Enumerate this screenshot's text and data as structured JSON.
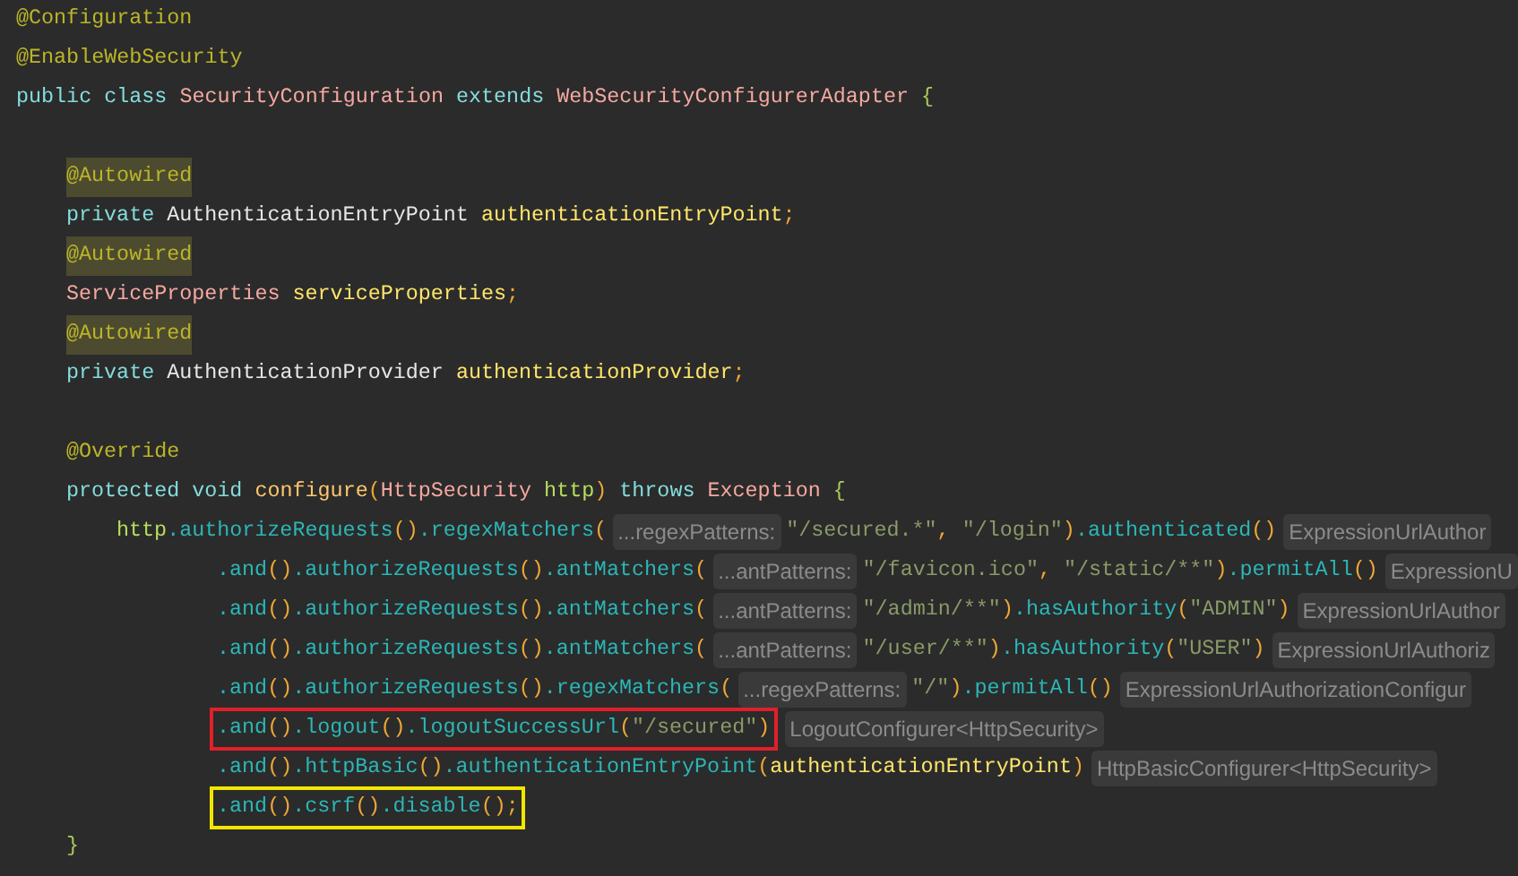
{
  "lines": [
    {
      "kind": "code",
      "tokens": [
        {
          "kind": "annotation",
          "text": "@Configuration",
          "highlighted": false
        }
      ]
    },
    {
      "kind": "code",
      "tokens": [
        {
          "kind": "annotation",
          "text": "@EnableWebSecurity",
          "highlighted": false
        }
      ]
    },
    {
      "kind": "code",
      "tokens": [
        {
          "kind": "keyword",
          "text": "public class "
        },
        {
          "kind": "type",
          "text": "SecurityConfiguration "
        },
        {
          "kind": "keyword",
          "text": "extends "
        },
        {
          "kind": "type",
          "text": "WebSecurityConfigurerAdapter "
        },
        {
          "kind": "brace",
          "text": "{"
        }
      ],
      "children": [
        {
          "kind": "blank"
        },
        {
          "kind": "code",
          "tokens": [
            {
              "kind": "annotation",
              "text": "@Autowired",
              "highlighted": true
            }
          ]
        },
        {
          "kind": "code",
          "tokens": [
            {
              "kind": "keyword",
              "text": "private "
            },
            {
              "kind": "plain",
              "text": "AuthenticationEntryPoint "
            },
            {
              "kind": "field",
              "text": "authenticationEntryPoint"
            },
            {
              "kind": "paren",
              "text": ";"
            }
          ]
        },
        {
          "kind": "code",
          "tokens": [
            {
              "kind": "annotation",
              "text": "@Autowired",
              "highlighted": true
            }
          ]
        },
        {
          "kind": "code",
          "tokens": [
            {
              "kind": "type",
              "text": "ServiceProperties "
            },
            {
              "kind": "field",
              "text": "serviceProperties"
            },
            {
              "kind": "paren",
              "text": ";"
            }
          ]
        },
        {
          "kind": "code",
          "tokens": [
            {
              "kind": "annotation",
              "text": "@Autowired",
              "highlighted": true
            }
          ]
        },
        {
          "kind": "code",
          "tokens": [
            {
              "kind": "keyword",
              "text": "private "
            },
            {
              "kind": "plain",
              "text": "AuthenticationProvider "
            },
            {
              "kind": "field",
              "text": "authenticationProvider"
            },
            {
              "kind": "paren",
              "text": ";"
            }
          ]
        },
        {
          "kind": "blank"
        },
        {
          "kind": "code",
          "tokens": [
            {
              "kind": "annotation",
              "text": "@Override",
              "highlighted": false
            }
          ]
        },
        {
          "kind": "code",
          "tokens": [
            {
              "kind": "keyword",
              "text": "protected void "
            },
            {
              "kind": "method-decl",
              "text": "configure"
            },
            {
              "kind": "paren",
              "text": "("
            },
            {
              "kind": "type",
              "text": "HttpSecurity "
            },
            {
              "kind": "variable",
              "text": "http"
            },
            {
              "kind": "paren",
              "text": ") "
            },
            {
              "kind": "keyword",
              "text": "throws "
            },
            {
              "kind": "type",
              "text": "Exception "
            },
            {
              "kind": "brace",
              "text": "{"
            }
          ],
          "children": [
            {
              "kind": "code",
              "tokens": [
                {
                  "kind": "variable",
                  "text": "http"
                },
                {
                  "kind": "method",
                  "text": ".authorizeRequests"
                },
                {
                  "kind": "paren",
                  "text": "()"
                },
                {
                  "kind": "method",
                  "text": ".regexMatchers"
                },
                {
                  "kind": "paren",
                  "text": "("
                },
                {
                  "kind": "param-hint",
                  "text": "...regexPatterns:"
                },
                {
                  "kind": "string",
                  "text": "\"/secured.*\""
                },
                {
                  "kind": "paren",
                  "text": ", "
                },
                {
                  "kind": "string",
                  "text": "\"/login\""
                },
                {
                  "kind": "paren",
                  "text": ")"
                },
                {
                  "kind": "method",
                  "text": ".authenticated"
                },
                {
                  "kind": "paren",
                  "text": "()"
                }
              ],
              "inlay": "ExpressionUrlAuthor",
              "children": [
                {
                  "kind": "code",
                  "tokens": [
                    {
                      "kind": "method",
                      "text": ".and"
                    },
                    {
                      "kind": "paren",
                      "text": "()"
                    },
                    {
                      "kind": "method",
                      "text": ".authorizeRequests"
                    },
                    {
                      "kind": "paren",
                      "text": "()"
                    },
                    {
                      "kind": "method",
                      "text": ".antMatchers"
                    },
                    {
                      "kind": "paren",
                      "text": "("
                    },
                    {
                      "kind": "param-hint",
                      "text": "...antPatterns:"
                    },
                    {
                      "kind": "string",
                      "text": "\"/favicon.ico\""
                    },
                    {
                      "kind": "paren",
                      "text": ", "
                    },
                    {
                      "kind": "string",
                      "text": "\"/static/**\""
                    },
                    {
                      "kind": "paren",
                      "text": ")"
                    },
                    {
                      "kind": "method",
                      "text": ".permitAll"
                    },
                    {
                      "kind": "paren",
                      "text": "()"
                    }
                  ],
                  "inlay": "ExpressionU"
                },
                {
                  "kind": "code",
                  "tokens": [
                    {
                      "kind": "method",
                      "text": ".and"
                    },
                    {
                      "kind": "paren",
                      "text": "()"
                    },
                    {
                      "kind": "method",
                      "text": ".authorizeRequests"
                    },
                    {
                      "kind": "paren",
                      "text": "()"
                    },
                    {
                      "kind": "method",
                      "text": ".antMatchers"
                    },
                    {
                      "kind": "paren",
                      "text": "("
                    },
                    {
                      "kind": "param-hint",
                      "text": "...antPatterns:"
                    },
                    {
                      "kind": "string",
                      "text": "\"/admin/**\""
                    },
                    {
                      "kind": "paren",
                      "text": ")"
                    },
                    {
                      "kind": "method",
                      "text": ".hasAuthority"
                    },
                    {
                      "kind": "paren",
                      "text": "("
                    },
                    {
                      "kind": "string",
                      "text": "\"ADMIN\""
                    },
                    {
                      "kind": "paren",
                      "text": ")"
                    }
                  ],
                  "inlay": "ExpressionUrlAuthor"
                },
                {
                  "kind": "code",
                  "tokens": [
                    {
                      "kind": "method",
                      "text": ".and"
                    },
                    {
                      "kind": "paren",
                      "text": "()"
                    },
                    {
                      "kind": "method",
                      "text": ".authorizeRequests"
                    },
                    {
                      "kind": "paren",
                      "text": "()"
                    },
                    {
                      "kind": "method",
                      "text": ".antMatchers"
                    },
                    {
                      "kind": "paren",
                      "text": "("
                    },
                    {
                      "kind": "param-hint",
                      "text": "...antPatterns:"
                    },
                    {
                      "kind": "string",
                      "text": "\"/user/**\""
                    },
                    {
                      "kind": "paren",
                      "text": ")"
                    },
                    {
                      "kind": "method",
                      "text": ".hasAuthority"
                    },
                    {
                      "kind": "paren",
                      "text": "("
                    },
                    {
                      "kind": "string",
                      "text": "\"USER\""
                    },
                    {
                      "kind": "paren",
                      "text": ")"
                    }
                  ],
                  "inlay": "ExpressionUrlAuthoriz"
                },
                {
                  "kind": "code",
                  "tokens": [
                    {
                      "kind": "method",
                      "text": ".and"
                    },
                    {
                      "kind": "paren",
                      "text": "()"
                    },
                    {
                      "kind": "method",
                      "text": ".authorizeRequests"
                    },
                    {
                      "kind": "paren",
                      "text": "()"
                    },
                    {
                      "kind": "method",
                      "text": ".regexMatchers"
                    },
                    {
                      "kind": "paren",
                      "text": "("
                    },
                    {
                      "kind": "param-hint",
                      "text": "...regexPatterns:"
                    },
                    {
                      "kind": "string",
                      "text": "\"/\""
                    },
                    {
                      "kind": "paren",
                      "text": ")"
                    },
                    {
                      "kind": "method",
                      "text": ".permitAll"
                    },
                    {
                      "kind": "paren",
                      "text": "()"
                    }
                  ],
                  "inlay": "ExpressionUrlAuthorizationConfigur"
                },
                {
                  "kind": "code",
                  "color": "#e0202a",
                  "tokens": [
                    {
                      "kind": "method",
                      "text": ".and"
                    },
                    {
                      "kind": "paren",
                      "text": "()"
                    },
                    {
                      "kind": "method",
                      "text": ".logout"
                    },
                    {
                      "kind": "paren",
                      "text": "()"
                    },
                    {
                      "kind": "method",
                      "text": ".logoutSuccessUrl"
                    },
                    {
                      "kind": "paren",
                      "text": "("
                    },
                    {
                      "kind": "string",
                      "text": "\"/secured\""
                    },
                    {
                      "kind": "paren",
                      "text": ")"
                    }
                  ],
                  "inlay": "LogoutConfigurer<HttpSecurity>"
                },
                {
                  "kind": "code",
                  "tokens": [
                    {
                      "kind": "method",
                      "text": ".and"
                    },
                    {
                      "kind": "paren",
                      "text": "()"
                    },
                    {
                      "kind": "method",
                      "text": ".httpBasic"
                    },
                    {
                      "kind": "paren",
                      "text": "()"
                    },
                    {
                      "kind": "method",
                      "text": ".authenticationEntryPoint"
                    },
                    {
                      "kind": "paren",
                      "text": "("
                    },
                    {
                      "kind": "field",
                      "text": "authenticationEntryPoint"
                    },
                    {
                      "kind": "paren",
                      "text": ")"
                    }
                  ],
                  "inlay": "HttpBasicConfigurer<HttpSecurity>"
                },
                {
                  "kind": "code",
                  "color": "#f2e600",
                  "tokens": [
                    {
                      "kind": "method",
                      "text": ".and"
                    },
                    {
                      "kind": "paren",
                      "text": "()"
                    },
                    {
                      "kind": "method",
                      "text": ".csrf"
                    },
                    {
                      "kind": "paren",
                      "text": "()"
                    },
                    {
                      "kind": "method",
                      "text": ".disable"
                    },
                    {
                      "kind": "paren",
                      "text": "();"
                    }
                  ]
                }
              ]
            }
          ]
        },
        {
          "kind": "code",
          "tokens": [
            {
              "kind": "brace",
              "text": "}"
            }
          ]
        }
      ]
    }
  ]
}
